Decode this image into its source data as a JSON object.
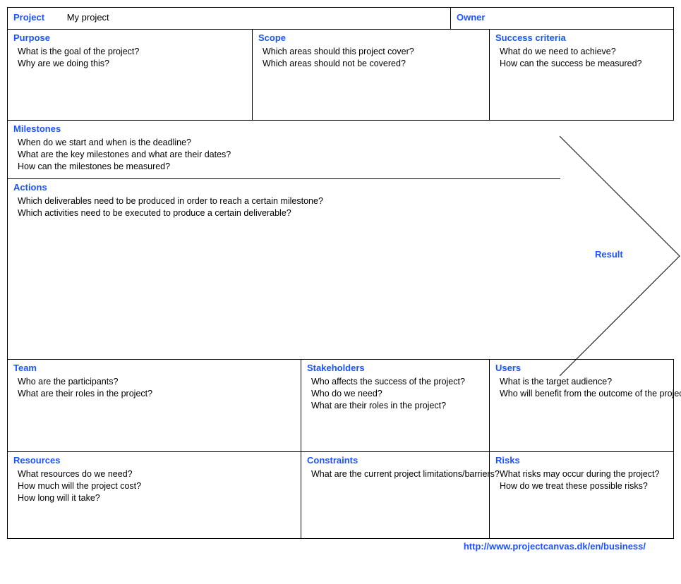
{
  "header": {
    "project_label": "Project",
    "project_name": "My project",
    "owner_label": "Owner"
  },
  "purpose": {
    "heading": "Purpose",
    "l1": "What is the goal of the project?",
    "l2": "Why are we doing this?"
  },
  "scope": {
    "heading": "Scope",
    "l1": "Which areas should this project cover?",
    "l2": "Which areas should not be covered?"
  },
  "success": {
    "heading": "Success criteria",
    "l1": "What do we need to achieve?",
    "l2": "How can the success be measured?"
  },
  "milestones": {
    "heading": "Milestones",
    "l1": "When do we start and when is the deadline?",
    "l2": "What are the key milestones and what are their dates?",
    "l3": "How can the milestones be measured?"
  },
  "actions": {
    "heading": "Actions",
    "l1": "Which deliverables need to be produced in order to reach a certain milestone?",
    "l2": "Which activities need to be executed to produce a certain deliverable?"
  },
  "result": {
    "heading": "Result"
  },
  "team": {
    "heading": "Team",
    "l1": "Who are the participants?",
    "l2": "What are their roles in the project?"
  },
  "stakeholders": {
    "heading": "Stakeholders",
    "l1": "Who affects the success of the project?",
    "l2": "Who do we need?",
    "l3": "What are their roles in the project?"
  },
  "users": {
    "heading": "Users",
    "l1": "What is the target audience?",
    "l2": "Who will benefit from the outcome of the project?"
  },
  "resources": {
    "heading": "Resources",
    "l1": "What resources do we need?",
    "l2": "How much will the project cost?",
    "l3": "How long will it take?"
  },
  "constraints": {
    "heading": "Constraints",
    "l1": "What are the current project limitations/barriers?"
  },
  "risks": {
    "heading": "Risks",
    "l1": "What risks may occur during the project?",
    "l2": "How do we treat these possible risks?"
  },
  "footer": {
    "url": "http://www.projectcanvas.dk/en/business/"
  }
}
